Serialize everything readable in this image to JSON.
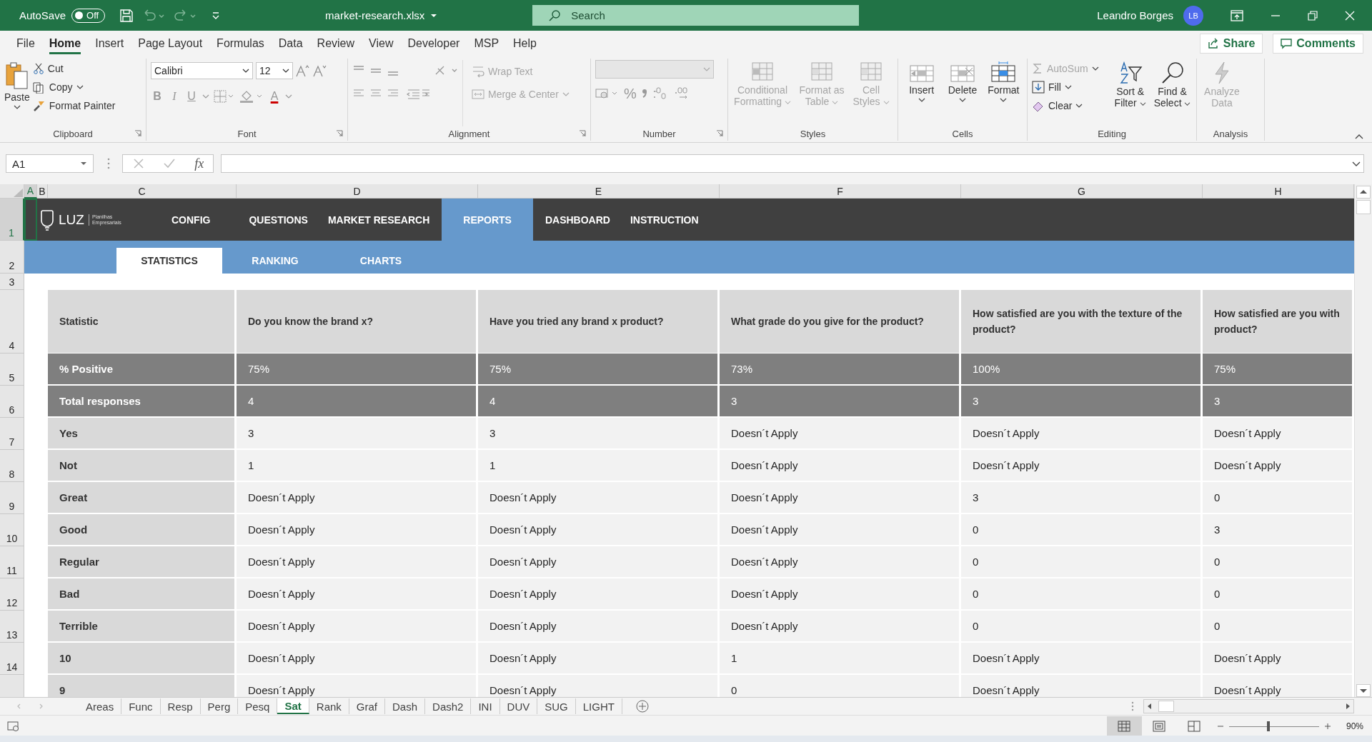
{
  "title_bar": {
    "autosave_label": "AutoSave",
    "autosave_toggle": {
      "label": "Off",
      "on": false
    },
    "file_name": "market-research.xlsx",
    "search": {
      "placeholder": "Search"
    },
    "user_name": "Leandro Borges",
    "avatar_initials": "LB"
  },
  "menu_tabs": [
    {
      "label": "File",
      "selected": false
    },
    {
      "label": "Home",
      "selected": true
    },
    {
      "label": "Insert",
      "selected": false
    },
    {
      "label": "Page Layout",
      "selected": false
    },
    {
      "label": "Formulas",
      "selected": false
    },
    {
      "label": "Data",
      "selected": false
    },
    {
      "label": "Review",
      "selected": false
    },
    {
      "label": "View",
      "selected": false
    },
    {
      "label": "Developer",
      "selected": false
    },
    {
      "label": "MSP",
      "selected": false
    },
    {
      "label": "Help",
      "selected": false
    }
  ],
  "share_button": "Share",
  "comments_button": "Comments",
  "ribbon": [
    {
      "kind": "clipboard",
      "label": "Clipboard",
      "launcher": true,
      "paste": "Paste",
      "cut": "Cut",
      "copy": "Copy",
      "format_painter": "Format Painter"
    },
    {
      "kind": "font",
      "label": "Font",
      "launcher": true,
      "font_name": "Calibri",
      "font_size": "12",
      "bold": "B",
      "italic": "I",
      "underline": "U",
      "font_color": "A"
    },
    {
      "kind": "alignment",
      "label": "Alignment",
      "launcher": true,
      "wrap_text": {
        "label": "Wrap Text",
        "disabled": true
      },
      "merge": {
        "label": "Merge & Center",
        "disabled": true
      }
    },
    {
      "kind": "number",
      "label": "Number",
      "launcher": true,
      "percent": "%"
    },
    {
      "kind": "styles",
      "label": "Styles",
      "launcher": false,
      "buttons": [
        {
          "label": "Conditional Formatting",
          "disabled": true
        },
        {
          "label": "Format as Table",
          "disabled": true
        },
        {
          "label": "Cell Styles",
          "disabled": true
        }
      ]
    },
    {
      "kind": "cells",
      "label": "Cells",
      "launcher": false,
      "buttons": [
        {
          "kind": "insert",
          "label": "Insert",
          "disabled": false
        },
        {
          "kind": "delete",
          "label": "Delete",
          "disabled": false
        },
        {
          "kind": "format",
          "label": "Format",
          "disabled": false
        }
      ]
    },
    {
      "kind": "editing",
      "label": "Editing",
      "launcher": false,
      "autosum": {
        "label": "AutoSum",
        "disabled": true
      },
      "fill": "Fill",
      "clear": "Clear",
      "sort": "Sort & Filter",
      "find": "Find & Select"
    },
    {
      "kind": "analysis",
      "label": "Analysis",
      "launcher": false,
      "analyze": {
        "label": "Analyze Data",
        "disabled": true
      }
    }
  ],
  "formula_bar": {
    "name_box": "A1",
    "function_label": "fx"
  },
  "columns": [
    {
      "label": "A",
      "selected": true
    },
    {
      "label": "B",
      "selected": false
    },
    {
      "label": "C",
      "selected": false
    },
    {
      "label": "D",
      "selected": false
    },
    {
      "label": "E",
      "selected": false
    },
    {
      "label": "F",
      "selected": false
    },
    {
      "label": "G",
      "selected": false
    },
    {
      "label": "H",
      "selected": false
    }
  ],
  "banner": {
    "rows": [
      {
        "row": "1",
        "selected": true
      },
      {
        "row": "2",
        "selected": false
      },
      {
        "row": "3",
        "selected": false
      }
    ],
    "logo": "LUZ",
    "logo_tagline": "Planilhas Empresariais",
    "nav": [
      {
        "label": "CONFIG",
        "selected": false
      },
      {
        "label": "QUESTIONS",
        "selected": false
      },
      {
        "label": "MARKET RESEARCH",
        "selected": false
      },
      {
        "label": "REPORTS",
        "selected": true
      },
      {
        "label": "DASHBOARD",
        "selected": false
      },
      {
        "label": "INSTRUCTION",
        "selected": false
      }
    ],
    "subnav": [
      {
        "label": "STATISTICS",
        "selected": true
      },
      {
        "label": "RANKING",
        "selected": false
      },
      {
        "label": "CHARTS",
        "selected": false
      }
    ]
  },
  "table": {
    "header": {
      "row": "4",
      "selected": false,
      "cells": [
        "Statistic",
        "Do you know the brand x?",
        "Have you tried any brand x product?",
        "What grade do you give for the product?",
        "How satisfied are you with the texture of the product?",
        "How satisfied are you with\nproduct?"
      ]
    },
    "rows": [
      {
        "row": "5",
        "selected": false,
        "kind": "summary",
        "label": "% Positive",
        "values": [
          "75%",
          "75%",
          "73%",
          "100%",
          "75%"
        ]
      },
      {
        "row": "6",
        "selected": false,
        "kind": "summary",
        "label": "Total responses",
        "values": [
          "4",
          "4",
          "3",
          "3",
          "3"
        ]
      },
      {
        "row": "7",
        "selected": false,
        "kind": "count",
        "label": "Yes",
        "values": [
          "3",
          "3",
          "Doesn´t Apply",
          "Doesn´t Apply",
          "Doesn´t Apply"
        ]
      },
      {
        "row": "8",
        "selected": false,
        "kind": "count",
        "label": "Not",
        "values": [
          "1",
          "1",
          "Doesn´t Apply",
          "Doesn´t Apply",
          "Doesn´t Apply"
        ]
      },
      {
        "row": "9",
        "selected": false,
        "kind": "count",
        "label": "Great",
        "values": [
          "Doesn´t Apply",
          "Doesn´t Apply",
          "Doesn´t Apply",
          "3",
          "0"
        ]
      },
      {
        "row": "10",
        "selected": false,
        "kind": "count",
        "label": "Good",
        "values": [
          "Doesn´t Apply",
          "Doesn´t Apply",
          "Doesn´t Apply",
          "0",
          "3"
        ]
      },
      {
        "row": "11",
        "selected": false,
        "kind": "count",
        "label": "Regular",
        "values": [
          "Doesn´t Apply",
          "Doesn´t Apply",
          "Doesn´t Apply",
          "0",
          "0"
        ]
      },
      {
        "row": "12",
        "selected": false,
        "kind": "count",
        "label": "Bad",
        "values": [
          "Doesn´t Apply",
          "Doesn´t Apply",
          "Doesn´t Apply",
          "0",
          "0"
        ]
      },
      {
        "row": "13",
        "selected": false,
        "kind": "count",
        "label": "Terrible",
        "values": [
          "Doesn´t Apply",
          "Doesn´t Apply",
          "Doesn´t Apply",
          "0",
          "0"
        ]
      },
      {
        "row": "14",
        "selected": false,
        "kind": "count",
        "label": "10",
        "values": [
          "Doesn´t Apply",
          "Doesn´t Apply",
          "1",
          "Doesn´t Apply",
          "Doesn´t Apply"
        ]
      },
      {
        "selected": false,
        "kind": "count",
        "label": "9",
        "values": [
          "Doesn´t Apply",
          "Doesn´t Apply",
          "0",
          "Doesn´t Apply",
          "Doesn´t Apply"
        ]
      }
    ]
  },
  "sheet_tabs": [
    {
      "label": "Areas",
      "selected": false
    },
    {
      "label": "Func",
      "selected": false
    },
    {
      "label": "Resp",
      "selected": false
    },
    {
      "label": "Perg",
      "selected": false
    },
    {
      "label": "Pesq",
      "selected": false
    },
    {
      "label": "Sat",
      "selected": true
    },
    {
      "label": "Rank",
      "selected": false
    },
    {
      "label": "Graf",
      "selected": false
    },
    {
      "label": "Dash",
      "selected": false
    },
    {
      "label": "Dash2",
      "selected": false
    },
    {
      "label": "INI",
      "selected": false
    },
    {
      "label": "DUV",
      "selected": false
    },
    {
      "label": "SUG",
      "selected": false
    },
    {
      "label": "LIGHT",
      "selected": false
    }
  ],
  "status_bar": {
    "views": [
      {
        "kind": "normal",
        "selected": true
      },
      {
        "kind": "page_layout",
        "selected": false
      },
      {
        "kind": "page_break",
        "selected": false
      }
    ],
    "zoom": {
      "level": 0.44,
      "reading": "90%"
    }
  }
}
